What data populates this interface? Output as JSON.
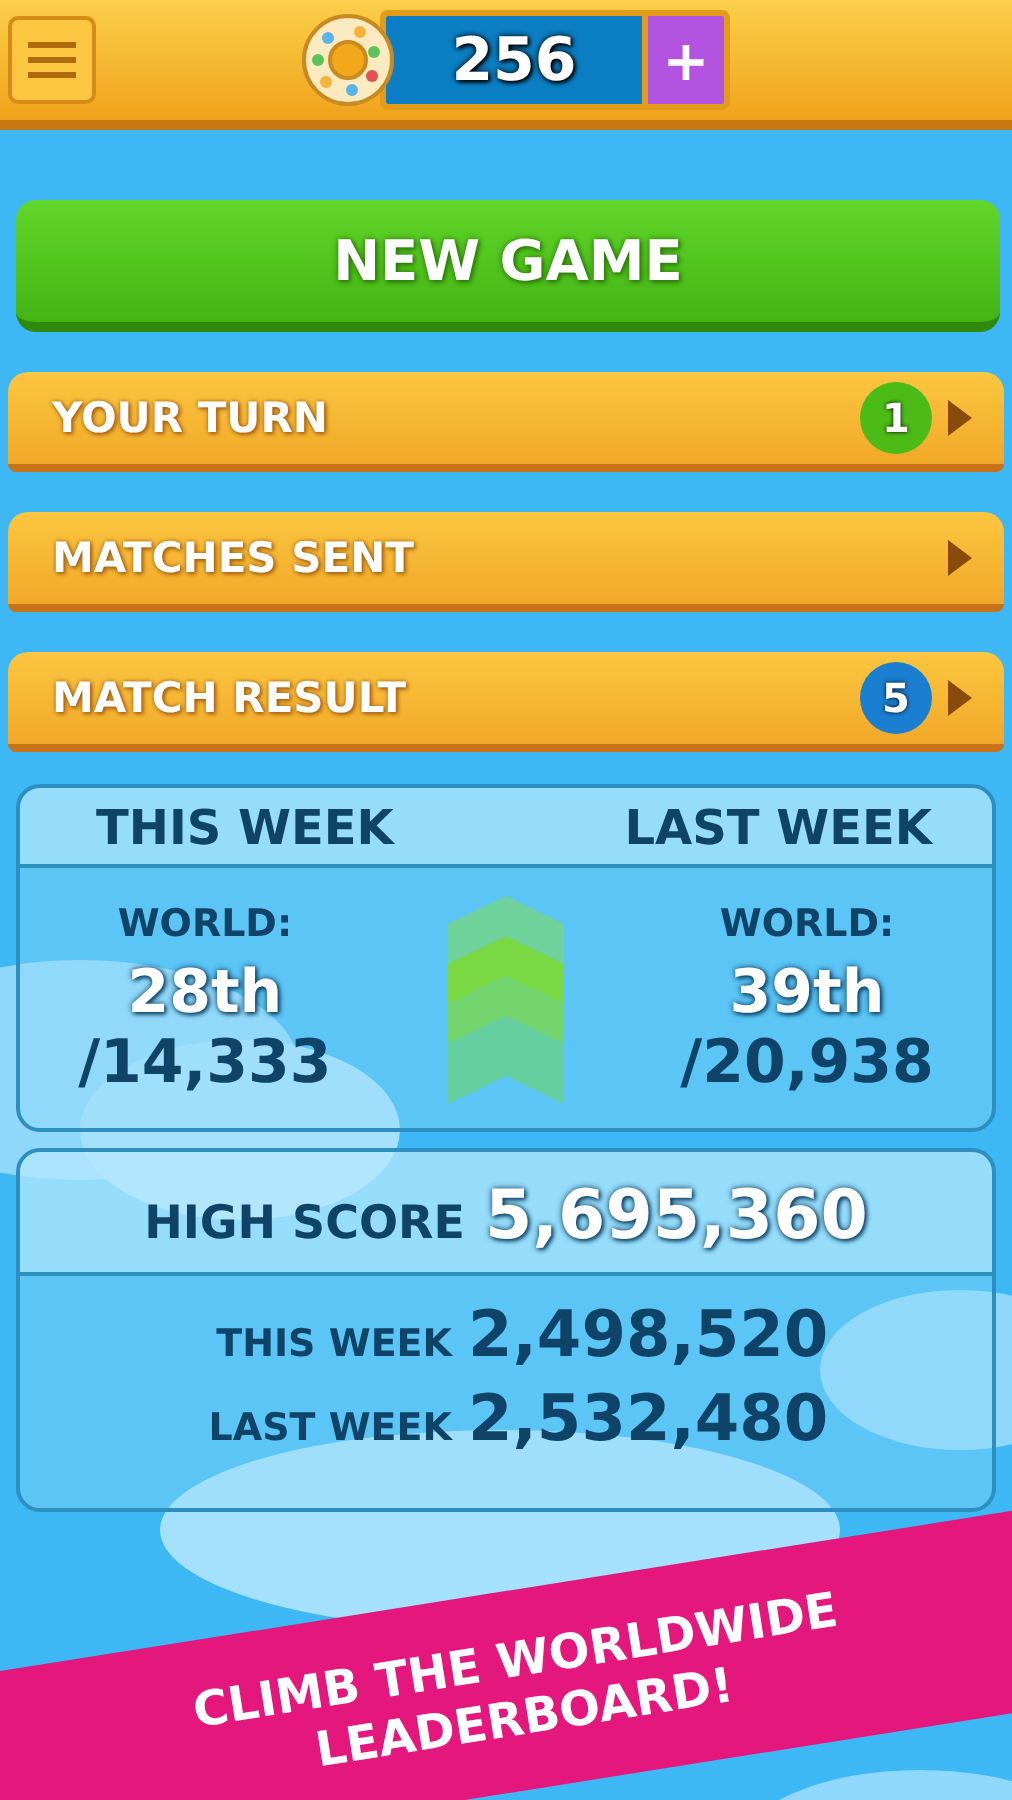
{
  "top_bar": {
    "coins": "256",
    "add_label": "+"
  },
  "new_game": {
    "label": "NEW GAME"
  },
  "menu_rows": [
    {
      "label": "YOUR TURN",
      "badge": {
        "text": "1",
        "color": "#4cbb17"
      }
    },
    {
      "label": "MATCHES SENT"
    },
    {
      "label": "MATCH RESULT",
      "badge": {
        "text": "5",
        "color": "#1a7fd0"
      }
    }
  ],
  "rankings": {
    "columns": [
      {
        "heading": "THIS WEEK",
        "label": "WORLD:",
        "rank": "28th",
        "total": "/14,333"
      },
      {
        "heading": "LAST WEEK",
        "label": "WORLD:",
        "rank": "39th",
        "total": "/20,938"
      }
    ]
  },
  "scores": {
    "high_label": "HIGH SCORE",
    "high_value": "5,695,360",
    "rows": [
      {
        "label": "THIS WEEK",
        "value": "2,498,520"
      },
      {
        "label": "LAST WEEK",
        "value": "2,532,480"
      }
    ]
  },
  "banner": {
    "text": "CLIMB THE WORLDWIDE LEADERBOARD!"
  }
}
